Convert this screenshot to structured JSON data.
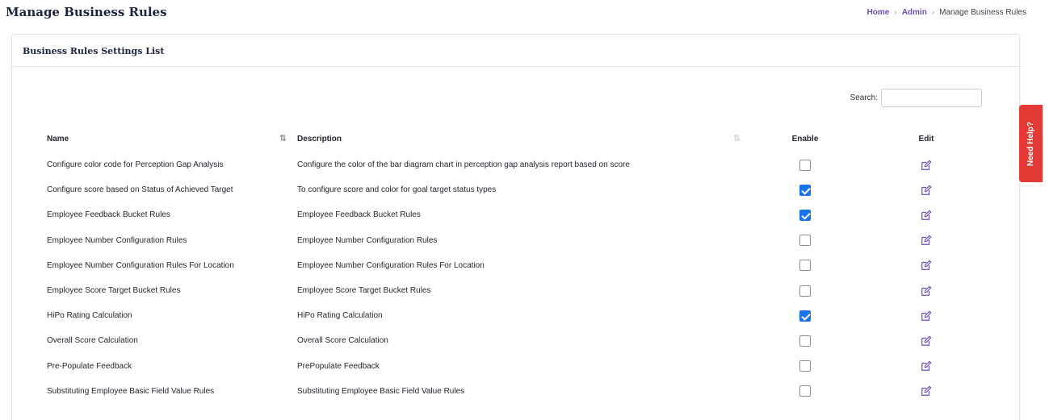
{
  "page": {
    "title": "Manage Business Rules",
    "breadcrumb": [
      "Home",
      "Admin",
      "Manage Business Rules"
    ]
  },
  "card": {
    "title": "Business Rules Settings List"
  },
  "search": {
    "label": "Search:",
    "value": "",
    "placeholder": ""
  },
  "table": {
    "headers": {
      "name": "Name",
      "description": "Description",
      "enable": "Enable",
      "edit": "Edit"
    },
    "rows": [
      {
        "name": "Configure color code for Perception Gap Analysis",
        "description": "Configure the color of the bar diagram chart in perception gap analysis report based on score",
        "enabled": false
      },
      {
        "name": "Configure score based on Status of Achieved Target",
        "description": "To configure score and color for goal target status types",
        "enabled": true
      },
      {
        "name": "Employee Feedback Bucket Rules",
        "description": "Employee Feedback Bucket Rules",
        "enabled": true
      },
      {
        "name": "Employee Number Configuration Rules",
        "description": "Employee Number Configuration Rules",
        "enabled": false
      },
      {
        "name": "Employee Number Configuration Rules For Location",
        "description": "Employee Number Configuration Rules For Location",
        "enabled": false
      },
      {
        "name": "Employee Score Target Bucket Rules",
        "description": "Employee Score Target Bucket Rules",
        "enabled": false
      },
      {
        "name": "HiPo Rating Calculation",
        "description": "HiPo Rating Calculation",
        "enabled": true
      },
      {
        "name": "Overall Score Calculation",
        "description": "Overall Score Calculation",
        "enabled": false
      },
      {
        "name": "Pre-Populate Feedback",
        "description": "PrePopulate Feedback",
        "enabled": false
      },
      {
        "name": "Substituting Employee Basic Field Value Rules",
        "description": "Substituting Employee Basic Field Value Rules",
        "enabled": false
      }
    ]
  },
  "help_tab": {
    "label": "Need Help?"
  },
  "colors": {
    "accent": "#6c4fb3",
    "checkbox_checked": "#1a73e8",
    "help_tab": "#e53935"
  }
}
